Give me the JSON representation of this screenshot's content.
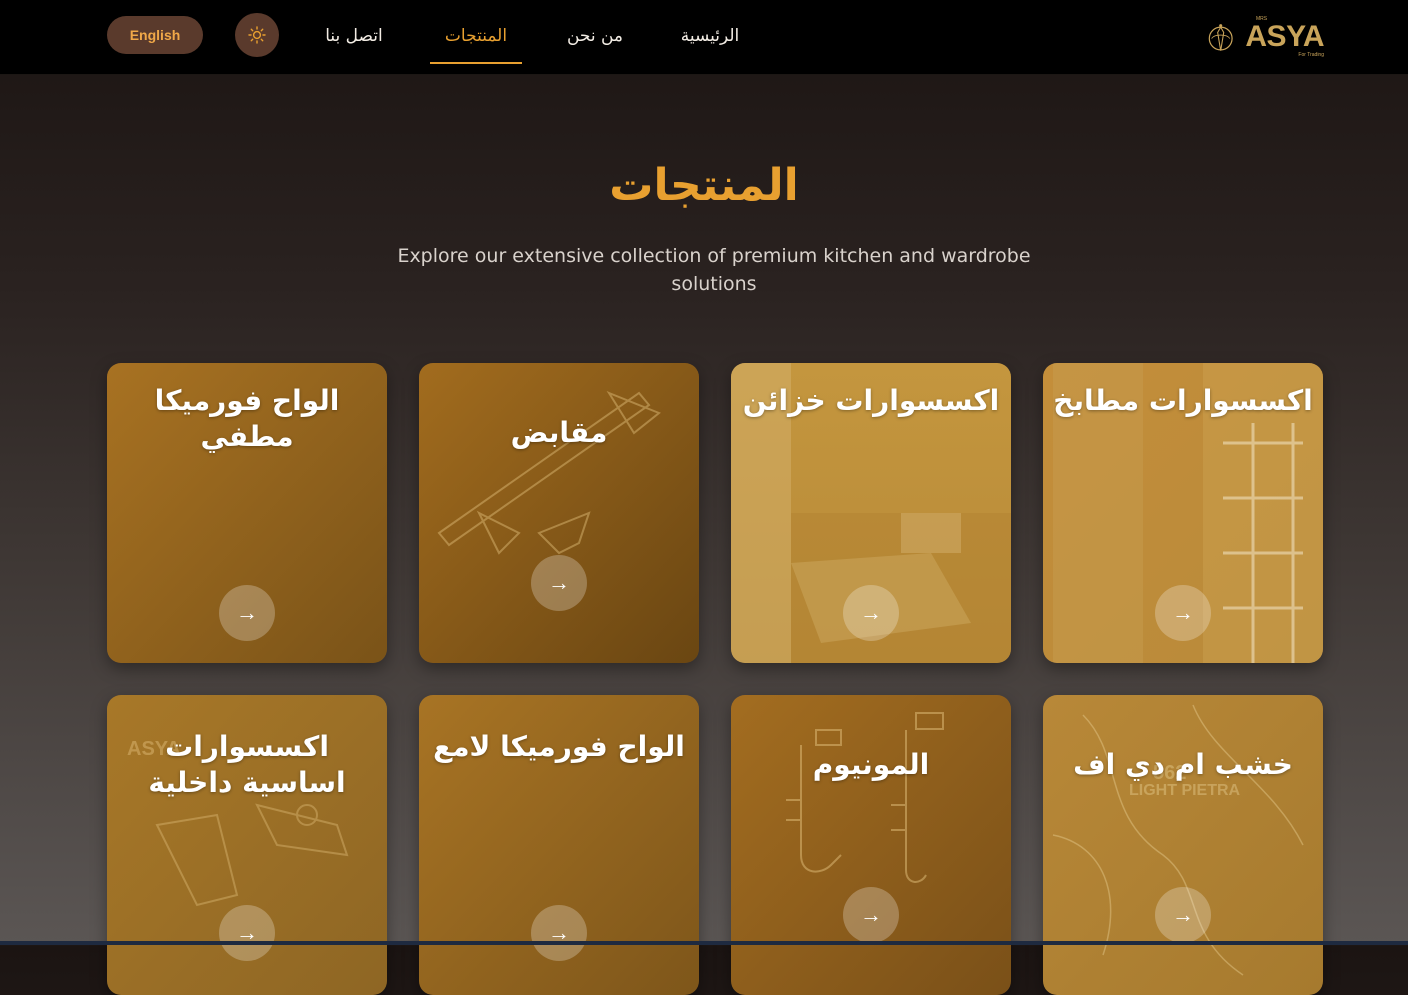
{
  "nav": {
    "language_label": "English",
    "theme_icon": "sun-icon",
    "links": [
      {
        "label": "الرئيسية"
      },
      {
        "label": "من نحن"
      },
      {
        "label": "المنتجات"
      },
      {
        "label": "اتصل بنا"
      }
    ],
    "active_link": "المنتجات",
    "logo": {
      "brand": "ASYA",
      "top": "MRS",
      "sub": "For Trading"
    }
  },
  "hero": {
    "title": "المنتجات",
    "subtitle": "Explore our extensive collection of premium kitchen and wardrobe solutions"
  },
  "products": [
    {
      "title": "اكسسوارات مطابخ",
      "arrow_icon": "arrow-right-icon"
    },
    {
      "title": "اكسسوارات خزائن",
      "arrow_icon": "arrow-right-icon"
    },
    {
      "title": "مقابض",
      "arrow_icon": "arrow-right-icon"
    },
    {
      "title": "الواح فورميكا مطفي",
      "arrow_icon": "arrow-right-icon"
    },
    {
      "title": "خشب ام دي اف",
      "art_text_1": "562",
      "art_text_2": "LIGHT PIETRA",
      "arrow_icon": "arrow-right-icon"
    },
    {
      "title": "المونيوم",
      "arrow_icon": "arrow-right-icon"
    },
    {
      "title": "الواح فورميكا لامع",
      "arrow_icon": "arrow-right-icon"
    },
    {
      "title": "اكسسوارات اساسية داخلية",
      "art_text_1": "ASYA",
      "arrow_icon": "arrow-right-icon"
    }
  ],
  "colors": {
    "accent": "#e8a030",
    "nav_bg": "#000000",
    "button_bg": "#5a3a2c",
    "card_gold": "#b8862e"
  }
}
